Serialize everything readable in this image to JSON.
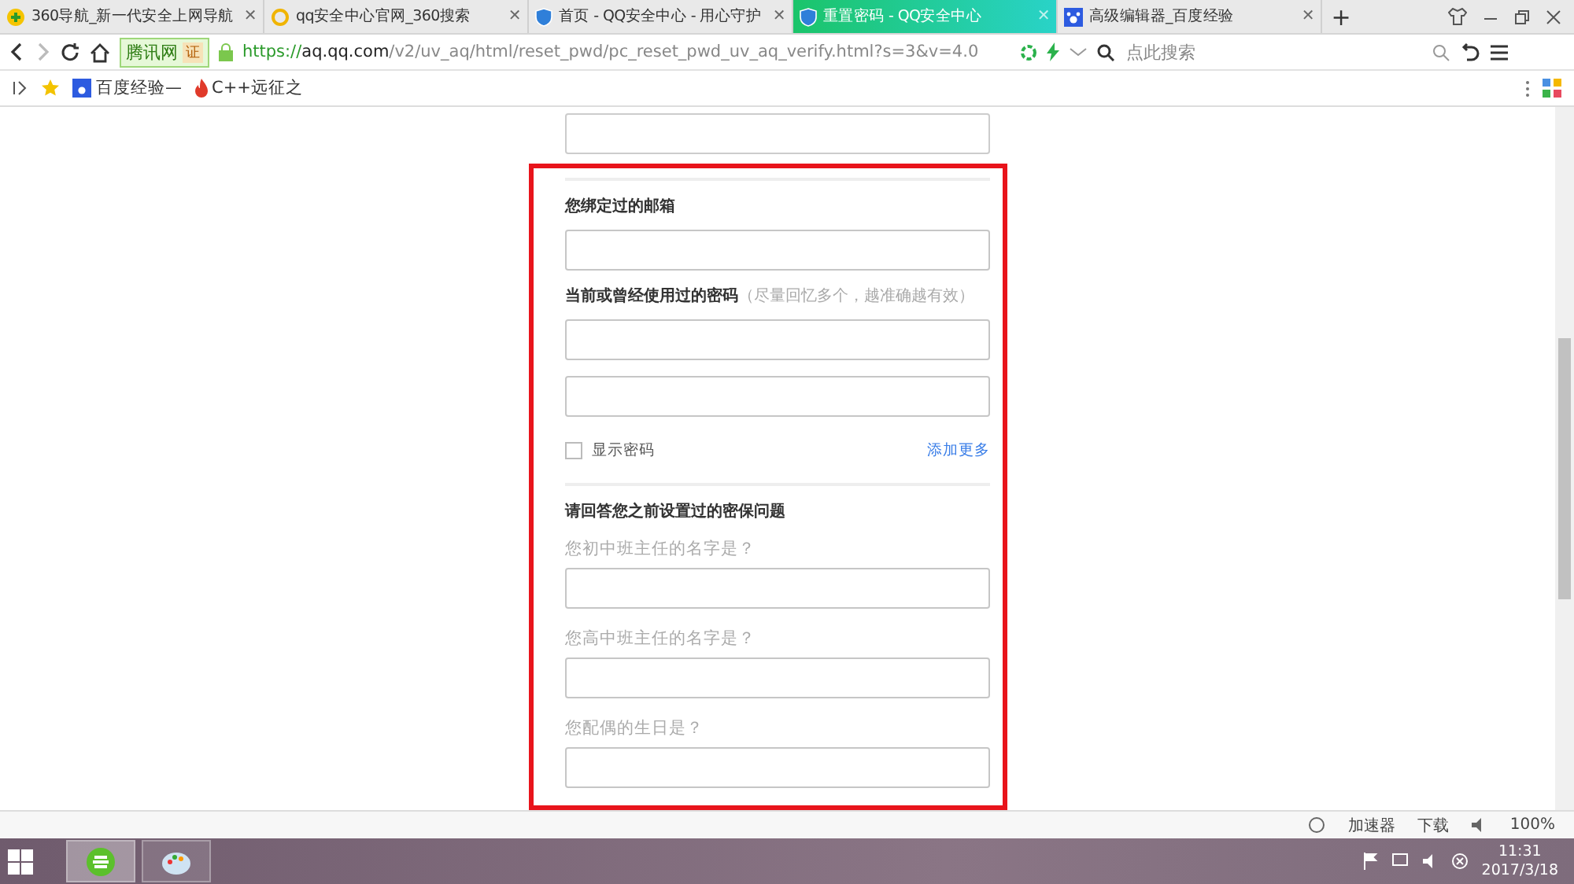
{
  "tabs": [
    {
      "title": "360导航_新一代安全上网导航",
      "selected": false
    },
    {
      "title": "qq安全中心官网_360搜索",
      "selected": false
    },
    {
      "title": "首页 - QQ安全中心 - 用心守护",
      "selected": false
    },
    {
      "title": "重置密码 - QQ安全中心",
      "selected": true
    },
    {
      "title": "高级编辑器_百度经验",
      "selected": false
    }
  ],
  "tab_close": "✕",
  "new_tab": "+",
  "address_bar": {
    "site_badge": "腾讯网",
    "cert_badge": "证",
    "url_scheme": "https://",
    "url_host": "aq.qq.com",
    "url_path": "/v2/uv_aq/html/reset_pwd/pc_reset_pwd_uv_aq_verify.html?s=3&v=4.0",
    "search_placeholder": "点此搜索"
  },
  "bookmarks": [
    "百度经验—",
    "C++远征之"
  ],
  "form": {
    "rows": [
      {
        "kind": "field"
      },
      {
        "kind": "divider"
      },
      {
        "kind": "label",
        "text": "您绑定过的邮箱"
      },
      {
        "kind": "field"
      },
      {
        "kind": "label",
        "text": "当前或曾经使用过的密码",
        "hint": "（尽量回忆多个，越准确越有效）"
      },
      {
        "kind": "field"
      },
      {
        "kind": "field"
      },
      {
        "kind": "checkrow",
        "text": "显示密码",
        "checked": false,
        "link": "添加更多"
      },
      {
        "kind": "divider"
      },
      {
        "kind": "label",
        "text": "请回答您之前设置过的密保问题"
      },
      {
        "kind": "question",
        "text": "您初中班主任的名字是？"
      },
      {
        "kind": "field"
      },
      {
        "kind": "question",
        "text": "您高中班主任的名字是？"
      },
      {
        "kind": "field"
      },
      {
        "kind": "question",
        "text": "您配偶的生日是？"
      },
      {
        "kind": "field"
      }
    ]
  },
  "status_bar": {
    "accelerator": "加速器",
    "downloads": "下载",
    "zoom": "100%"
  },
  "taskbar": {
    "apps": [
      {
        "selected": true
      },
      {
        "selected": false
      }
    ],
    "time": "11:31",
    "date": "2017/3/18"
  }
}
